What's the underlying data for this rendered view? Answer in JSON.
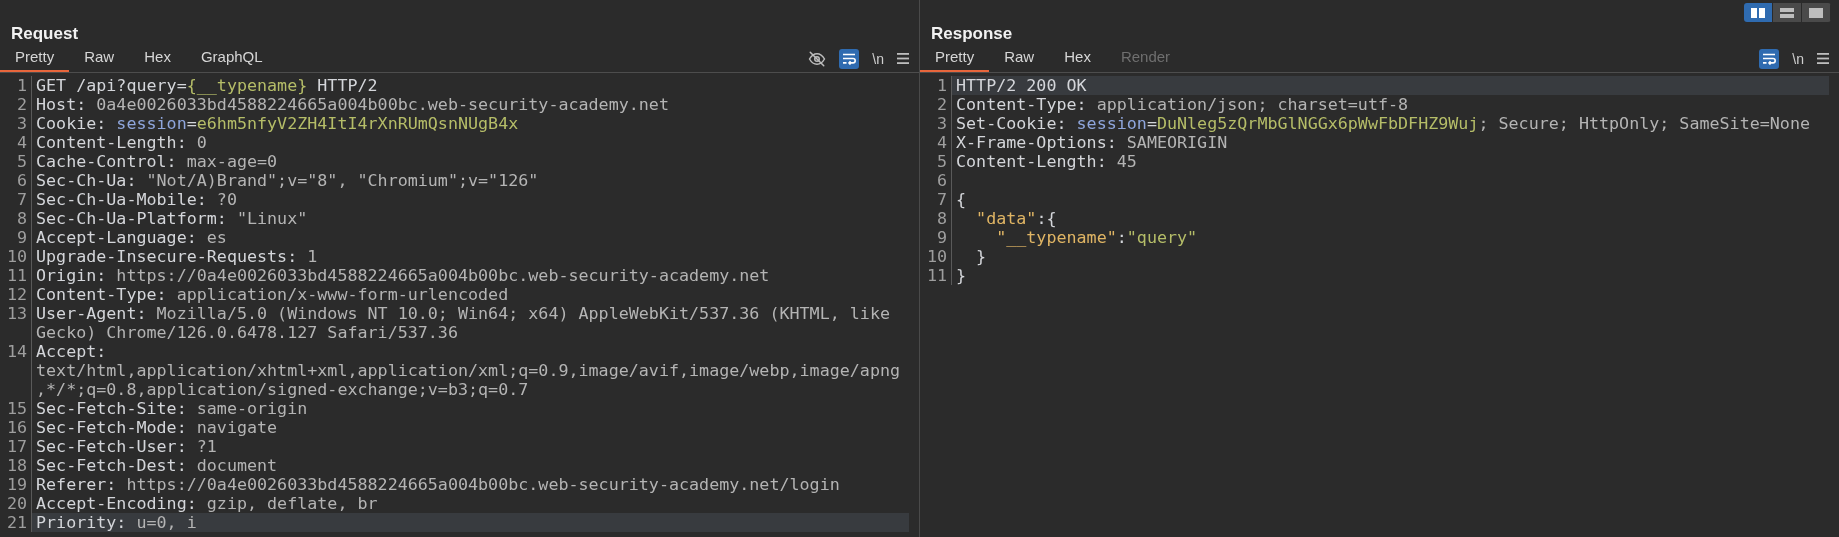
{
  "layout_buttons": [
    {
      "selected": true
    },
    {
      "selected": false
    },
    {
      "selected": false
    }
  ],
  "panels": [
    {
      "title": "Request",
      "tabs": [
        {
          "label": "Pretty",
          "selected": true,
          "disabled": false
        },
        {
          "label": "Raw",
          "selected": false,
          "disabled": false
        },
        {
          "label": "Hex",
          "selected": false,
          "disabled": false
        },
        {
          "label": "GraphQL",
          "selected": false,
          "disabled": false
        }
      ],
      "toolbar": {
        "hide_icon": true,
        "wrap_on": true,
        "newline_label": "\\n"
      },
      "lines": [
        {
          "number": "1",
          "highlighted": false,
          "rows": [
            [
              {
                "text": "GET /api?query=",
                "kind": "key"
              },
              {
                "text": "{__typename}",
                "kind": "green"
              },
              {
                "text": " HTTP/2",
                "kind": "key"
              }
            ]
          ]
        },
        {
          "number": "2",
          "highlighted": false,
          "rows": [
            [
              {
                "text": "Host:",
                "kind": "key"
              },
              {
                "text": " 0a4e0026033bd4588224665a004b00bc.web-security-academy.net",
                "kind": "value"
              }
            ]
          ]
        },
        {
          "number": "3",
          "highlighted": false,
          "rows": [
            [
              {
                "text": "Cookie:",
                "kind": "key"
              },
              {
                "text": " session",
                "kind": "blue"
              },
              {
                "text": "=",
                "kind": "key"
              },
              {
                "text": "e6hm5nfyV2ZH4ItI4rXnRUmQsnNUgB4x",
                "kind": "green"
              }
            ]
          ]
        },
        {
          "number": "4",
          "highlighted": false,
          "rows": [
            [
              {
                "text": "Content-Length:",
                "kind": "key"
              },
              {
                "text": " 0",
                "kind": "value"
              }
            ]
          ]
        },
        {
          "number": "5",
          "highlighted": false,
          "rows": [
            [
              {
                "text": "Cache-Control:",
                "kind": "key"
              },
              {
                "text": " max-age=0",
                "kind": "value"
              }
            ]
          ]
        },
        {
          "number": "6",
          "highlighted": false,
          "rows": [
            [
              {
                "text": "Sec-Ch-Ua:",
                "kind": "key"
              },
              {
                "text": " \"Not/A)Brand\";v=\"8\", \"Chromium\";v=\"126\"",
                "kind": "value"
              }
            ]
          ]
        },
        {
          "number": "7",
          "highlighted": false,
          "rows": [
            [
              {
                "text": "Sec-Ch-Ua-Mobile:",
                "kind": "key"
              },
              {
                "text": " ?0",
                "kind": "value"
              }
            ]
          ]
        },
        {
          "number": "8",
          "highlighted": false,
          "rows": [
            [
              {
                "text": "Sec-Ch-Ua-Platform:",
                "kind": "key"
              },
              {
                "text": " \"Linux\"",
                "kind": "value"
              }
            ]
          ]
        },
        {
          "number": "9",
          "highlighted": false,
          "rows": [
            [
              {
                "text": "Accept-Language:",
                "kind": "key"
              },
              {
                "text": " es",
                "kind": "value"
              }
            ]
          ]
        },
        {
          "number": "10",
          "highlighted": false,
          "rows": [
            [
              {
                "text": "Upgrade-Insecure-Requests:",
                "kind": "key"
              },
              {
                "text": " 1",
                "kind": "value"
              }
            ]
          ]
        },
        {
          "number": "11",
          "highlighted": false,
          "rows": [
            [
              {
                "text": "Origin:",
                "kind": "key"
              },
              {
                "text": " https://0a4e0026033bd4588224665a004b00bc.web-security-academy.net",
                "kind": "value"
              }
            ]
          ]
        },
        {
          "number": "12",
          "highlighted": false,
          "rows": [
            [
              {
                "text": "Content-Type:",
                "kind": "key"
              },
              {
                "text": " application/x-www-form-urlencoded",
                "kind": "value"
              }
            ]
          ]
        },
        {
          "number": "13",
          "highlighted": false,
          "rows": [
            [
              {
                "text": "User-Agent:",
                "kind": "key"
              },
              {
                "text": " Mozilla/5.0 (Windows NT 10.0; Win64; x64) AppleWebKit/537.36 (KHTML, like",
                "kind": "value"
              }
            ],
            [
              {
                "text": "Gecko) Chrome/126.0.6478.127 Safari/537.36",
                "kind": "value"
              }
            ]
          ]
        },
        {
          "number": "14",
          "highlighted": false,
          "rows": [
            [
              {
                "text": "Accept:",
                "kind": "key"
              }
            ],
            [
              {
                "text": "text/html,application/xhtml+xml,application/xml;q=0.9,image/avif,image/webp,image/apng",
                "kind": "value"
              }
            ],
            [
              {
                "text": ",*/*;q=0.8,application/signed-exchange;v=b3;q=0.7",
                "kind": "value"
              }
            ]
          ]
        },
        {
          "number": "15",
          "highlighted": false,
          "rows": [
            [
              {
                "text": "Sec-Fetch-Site:",
                "kind": "key"
              },
              {
                "text": " same-origin",
                "kind": "value"
              }
            ]
          ]
        },
        {
          "number": "16",
          "highlighted": false,
          "rows": [
            [
              {
                "text": "Sec-Fetch-Mode:",
                "kind": "key"
              },
              {
                "text": " navigate",
                "kind": "value"
              }
            ]
          ]
        },
        {
          "number": "17",
          "highlighted": false,
          "rows": [
            [
              {
                "text": "Sec-Fetch-User:",
                "kind": "key"
              },
              {
                "text": " ?1",
                "kind": "value"
              }
            ]
          ]
        },
        {
          "number": "18",
          "highlighted": false,
          "rows": [
            [
              {
                "text": "Sec-Fetch-Dest:",
                "kind": "key"
              },
              {
                "text": " document",
                "kind": "value"
              }
            ]
          ]
        },
        {
          "number": "19",
          "highlighted": false,
          "rows": [
            [
              {
                "text": "Referer:",
                "kind": "key"
              },
              {
                "text": " https://0a4e0026033bd4588224665a004b00bc.web-security-academy.net/login",
                "kind": "value"
              }
            ]
          ]
        },
        {
          "number": "20",
          "highlighted": false,
          "rows": [
            [
              {
                "text": "Accept-Encoding:",
                "kind": "key"
              },
              {
                "text": " gzip, deflate, br",
                "kind": "value"
              }
            ]
          ]
        },
        {
          "number": "21",
          "highlighted": true,
          "rows": [
            [
              {
                "text": "Priority:",
                "kind": "key"
              },
              {
                "text": " u=0, i",
                "kind": "value"
              }
            ]
          ]
        }
      ]
    },
    {
      "title": "Response",
      "tabs": [
        {
          "label": "Pretty",
          "selected": true,
          "disabled": false
        },
        {
          "label": "Raw",
          "selected": false,
          "disabled": false
        },
        {
          "label": "Hex",
          "selected": false,
          "disabled": false
        },
        {
          "label": "Render",
          "selected": false,
          "disabled": true
        }
      ],
      "toolbar": {
        "wrap_on": true,
        "newline_label": "\\n"
      },
      "lines": [
        {
          "number": "1",
          "highlighted": true,
          "rows": [
            [
              {
                "text": "HTTP/2 200 OK",
                "kind": "key"
              }
            ]
          ]
        },
        {
          "number": "2",
          "highlighted": false,
          "rows": [
            [
              {
                "text": "Content-Type:",
                "kind": "key"
              },
              {
                "text": " application/json; charset=utf-8",
                "kind": "value"
              }
            ]
          ]
        },
        {
          "number": "3",
          "highlighted": false,
          "rows": [
            [
              {
                "text": "Set-Cookie:",
                "kind": "key"
              },
              {
                "text": " session",
                "kind": "blue"
              },
              {
                "text": "=",
                "kind": "key"
              },
              {
                "text": "DuNleg5zQrMbGlNGGx6pWwFbDFHZ9Wuj",
                "kind": "green"
              },
              {
                "text": "; Secure; HttpOnly; SameSite=None",
                "kind": "value"
              }
            ]
          ]
        },
        {
          "number": "4",
          "highlighted": false,
          "rows": [
            [
              {
                "text": "X-Frame-Options:",
                "kind": "key"
              },
              {
                "text": " SAMEORIGIN",
                "kind": "value"
              }
            ]
          ]
        },
        {
          "number": "5",
          "highlighted": false,
          "rows": [
            [
              {
                "text": "Content-Length:",
                "kind": "key"
              },
              {
                "text": " 45",
                "kind": "value"
              }
            ]
          ]
        },
        {
          "number": "6",
          "highlighted": false,
          "rows": [
            []
          ]
        },
        {
          "number": "7",
          "highlighted": false,
          "rows": [
            [
              {
                "text": "{",
                "kind": "key"
              }
            ]
          ]
        },
        {
          "number": "8",
          "highlighted": false,
          "rows": [
            [
              {
                "text": "  \"data\"",
                "kind": "orange"
              },
              {
                "text": ":{",
                "kind": "key"
              }
            ]
          ]
        },
        {
          "number": "9",
          "highlighted": false,
          "rows": [
            [
              {
                "text": "    \"__typename\"",
                "kind": "orange"
              },
              {
                "text": ":",
                "kind": "key"
              },
              {
                "text": "\"query\"",
                "kind": "green"
              }
            ]
          ]
        },
        {
          "number": "10",
          "highlighted": false,
          "rows": [
            [
              {
                "text": "  }",
                "kind": "key"
              }
            ]
          ]
        },
        {
          "number": "11",
          "highlighted": false,
          "rows": [
            [
              {
                "text": "}",
                "kind": "key"
              }
            ]
          ]
        }
      ]
    }
  ]
}
